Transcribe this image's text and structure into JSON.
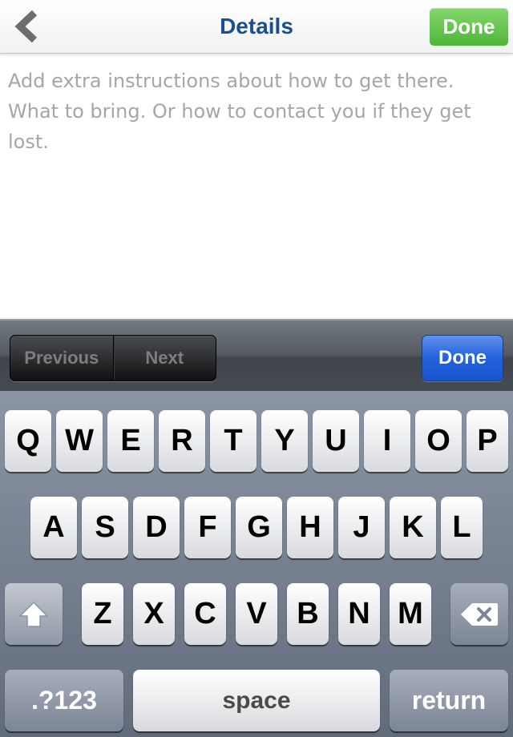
{
  "navbar": {
    "back_icon": "chevron-left-icon",
    "title": "Details",
    "done_label": "Done"
  },
  "details": {
    "placeholder": "Add extra instructions about how to get there. What to bring. Or how to contact you if they get lost.",
    "value": ""
  },
  "accessory": {
    "previous_label": "Previous",
    "next_label": "Next",
    "done_label": "Done"
  },
  "keyboard": {
    "row1": [
      "Q",
      "W",
      "E",
      "R",
      "T",
      "Y",
      "U",
      "I",
      "O",
      "P"
    ],
    "row2": [
      "A",
      "S",
      "D",
      "F",
      "G",
      "H",
      "J",
      "K",
      "L"
    ],
    "row3": [
      "Z",
      "X",
      "C",
      "V",
      "B",
      "N",
      "M"
    ],
    "shift_icon": "shift-arrow-icon",
    "delete_icon": "backspace-icon",
    "numbers_label": ".?123",
    "space_label": "space",
    "return_label": "return"
  },
  "colors": {
    "title": "#1a4f93",
    "done_green": "#4eb53b",
    "done_blue": "#2362dc",
    "placeholder": "#a6a6a6"
  }
}
